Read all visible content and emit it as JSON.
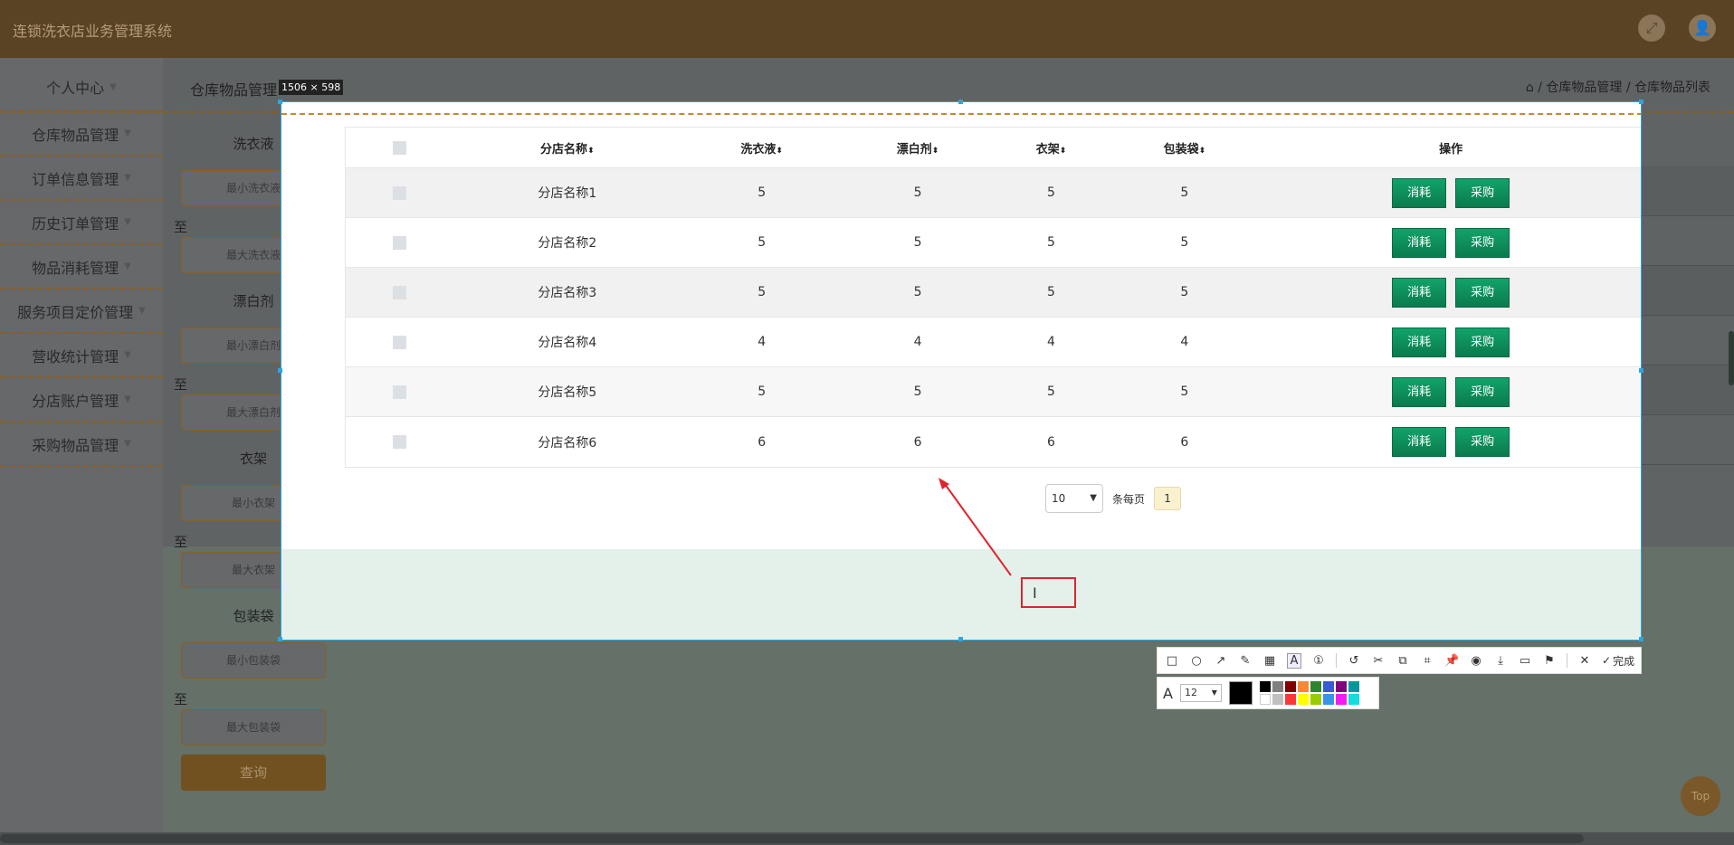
{
  "header": {
    "app_title": "连锁洗衣店业务管理系统",
    "fullscreen_icon": "fullscreen-icon",
    "avatar_icon": "user-icon"
  },
  "sidebar": {
    "items": [
      {
        "label": "个人中心"
      },
      {
        "label": "仓库物品管理"
      },
      {
        "label": "订单信息管理"
      },
      {
        "label": "历史订单管理"
      },
      {
        "label": "物品消耗管理"
      },
      {
        "label": "服务项目定价管理"
      },
      {
        "label": "营收统计管理"
      },
      {
        "label": "分店账户管理"
      },
      {
        "label": "采购物品管理"
      }
    ]
  },
  "page": {
    "title": "仓库物品管理",
    "breadcrumb": "仓库物品管理 / 仓库物品列表"
  },
  "filters": {
    "to": "至",
    "detergent": {
      "label": "洗衣液",
      "min": "最小洗衣液",
      "max": "最大洗衣液"
    },
    "bleach": {
      "label": "漂白剂",
      "min": "最小漂白剂",
      "max": "最大漂白剂"
    },
    "hanger": {
      "label": "衣架",
      "min": "最小衣架",
      "max": "最大衣架"
    },
    "bag": {
      "label": "包装袋",
      "min": "最小包装袋",
      "max": "最大包装袋"
    },
    "search": "查询"
  },
  "selection": {
    "size_label": "1506 × 598"
  },
  "table": {
    "headers": {
      "name": "分店名称",
      "detergent": "洗衣液",
      "bleach": "漂白剂",
      "hanger": "衣架",
      "bag": "包装袋",
      "op": "操作"
    },
    "rows": [
      {
        "name": "分店名称1",
        "detergent": "5",
        "bleach": "5",
        "hanger": "5",
        "bag": "5"
      },
      {
        "name": "分店名称2",
        "detergent": "5",
        "bleach": "5",
        "hanger": "5",
        "bag": "5"
      },
      {
        "name": "分店名称3",
        "detergent": "5",
        "bleach": "5",
        "hanger": "5",
        "bag": "5"
      },
      {
        "name": "分店名称4",
        "detergent": "4",
        "bleach": "4",
        "hanger": "4",
        "bag": "4"
      },
      {
        "name": "分店名称5",
        "detergent": "5",
        "bleach": "5",
        "hanger": "5",
        "bag": "5"
      },
      {
        "name": "分店名称6",
        "detergent": "6",
        "bleach": "6",
        "hanger": "6",
        "bag": "6"
      }
    ],
    "consume_label": "消耗",
    "purchase_label": "采购"
  },
  "pager": {
    "page_size": "10",
    "per_page_label": "条每页",
    "current_page": "1"
  },
  "toolbar": {
    "done_label": "完成",
    "font_size": "12",
    "current_color": "#000000",
    "palette": [
      "#000000",
      "#808080",
      "#800000",
      "#f7883a",
      "#308430",
      "#385ad3",
      "#800080",
      "#009999",
      "#ffffff",
      "#c0c0c0",
      "#fb3838",
      "#ffff00",
      "#99cc00",
      "#3894e4",
      "#f31bf3",
      "#16dcdc"
    ]
  },
  "back_to_top": "Top"
}
